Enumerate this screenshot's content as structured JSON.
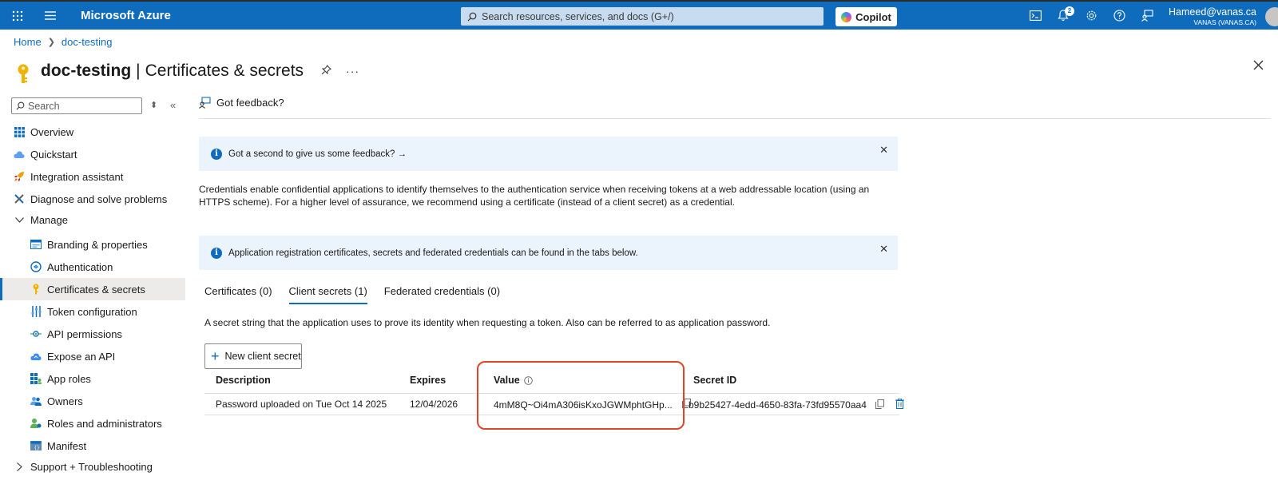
{
  "topbar": {
    "brand": "Microsoft Azure",
    "search_placeholder": "Search resources, services, and docs (G+/)",
    "copilot_label": "Copilot",
    "notification_count": "2",
    "user_email": "Hameed@vanas.ca",
    "user_tenant": "VANAS (VANAS.CA)"
  },
  "breadcrumb": {
    "home": "Home",
    "current": "doc-testing"
  },
  "header": {
    "app_name": "doc-testing",
    "separator": "|",
    "page_title": "Certificates & secrets"
  },
  "sidebar": {
    "search_placeholder": "Search",
    "items": [
      {
        "label": "Overview"
      },
      {
        "label": "Quickstart"
      },
      {
        "label": "Integration assistant"
      },
      {
        "label": "Diagnose and solve problems"
      },
      {
        "label": "Manage"
      },
      {
        "label": "Branding & properties"
      },
      {
        "label": "Authentication"
      },
      {
        "label": "Certificates & secrets"
      },
      {
        "label": "Token configuration"
      },
      {
        "label": "API permissions"
      },
      {
        "label": "Expose an API"
      },
      {
        "label": "App roles"
      },
      {
        "label": "Owners"
      },
      {
        "label": "Roles and administrators"
      },
      {
        "label": "Manifest"
      },
      {
        "label": "Support + Troubleshooting"
      }
    ]
  },
  "main": {
    "feedback_label": "Got feedback?",
    "banner1_text": "Got a second to give us some feedback? →",
    "description": "Credentials enable confidential applications to identify themselves to the authentication service when receiving tokens at a web addressable location (using an HTTPS scheme). For a higher level of assurance, we recommend using a certificate (instead of a client secret) as a credential.",
    "banner2_text": "Application registration certificates, secrets and federated credentials can be found in the tabs below.",
    "tabs": [
      {
        "label": "Certificates (0)"
      },
      {
        "label": "Client secrets (1)"
      },
      {
        "label": "Federated credentials (0)"
      }
    ],
    "tab_description": "A secret string that the application uses to prove its identity when requesting a token. Also can be referred to as application password.",
    "new_secret_label": "New client secret",
    "table": {
      "headers": [
        "Description",
        "Expires",
        "Value",
        "Secret ID"
      ],
      "rows": [
        {
          "description": "Password uploaded on Tue Oct 14 2025",
          "expires": "12/04/2026",
          "value": "4mM8Q~Oi4mA306isKxoJGWMphtGHp...",
          "secret_id": "b9b25427-4edd-4650-83fa-73fd95570aa4"
        }
      ]
    }
  },
  "colors": {
    "topbar": "#0f6cbd",
    "accent": "#0f6cbd",
    "highlight": "#e0452b",
    "info_bg": "#ebf3fc"
  }
}
